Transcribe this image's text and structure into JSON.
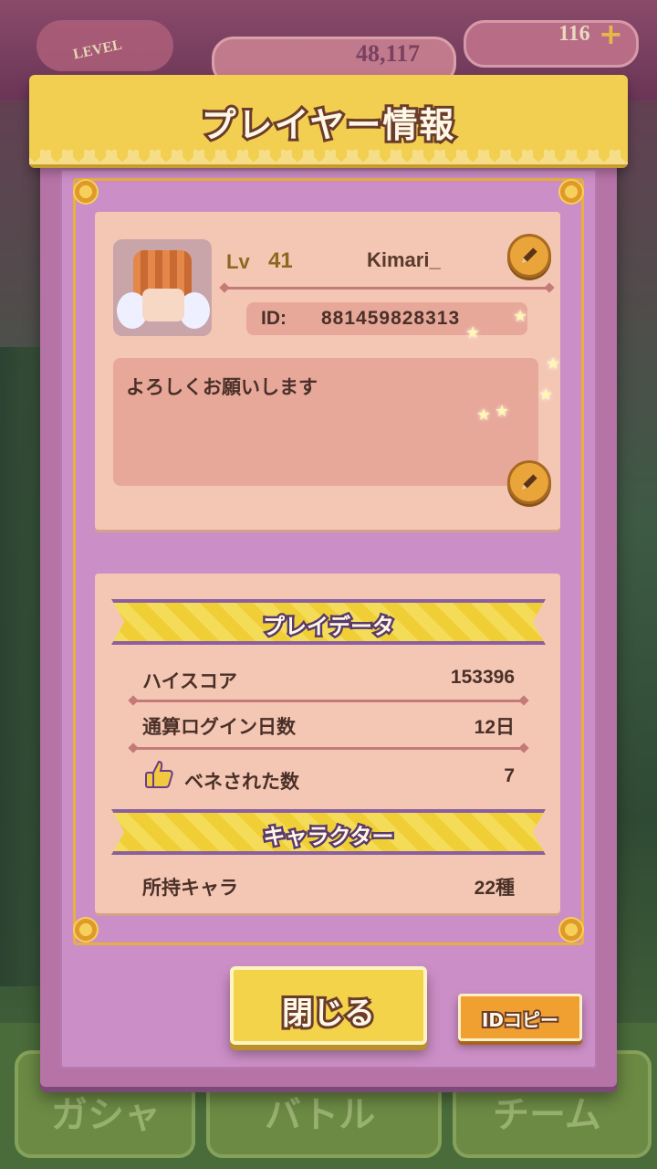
{
  "background": {
    "level_badge": "LEVEL",
    "score": "48,117",
    "gems": "116",
    "plus": "+",
    "tabs": [
      "ガシャ",
      "バトル",
      "チーム"
    ]
  },
  "dialog": {
    "title": "プレイヤー情報",
    "profile": {
      "level_label": "Lv",
      "level_value": "41",
      "name": "Kimari_",
      "id_label": "ID:",
      "id_value": "881459828313",
      "comment": "よろしくお願いします"
    },
    "play_data": {
      "heading": "プレイデータ",
      "rows": [
        {
          "label": "ハイスコア",
          "value": "153396"
        },
        {
          "label": "通算ログイン日数",
          "value": "12日"
        },
        {
          "label": "ベネされた数",
          "value": "7"
        }
      ]
    },
    "character": {
      "heading": "キャラクター",
      "rows": [
        {
          "label": "所持キャラ",
          "value": "22種"
        }
      ]
    },
    "buttons": {
      "close": "閉じる",
      "copy_id": "IDコピー"
    }
  },
  "icons": {
    "edit": "pencil-icon",
    "like": "thumbs-up-icon"
  },
  "colors": {
    "banner": "#f2cf50",
    "dialog": "#b573a6",
    "card": "#f4c7b4",
    "text": "#4a3028"
  }
}
